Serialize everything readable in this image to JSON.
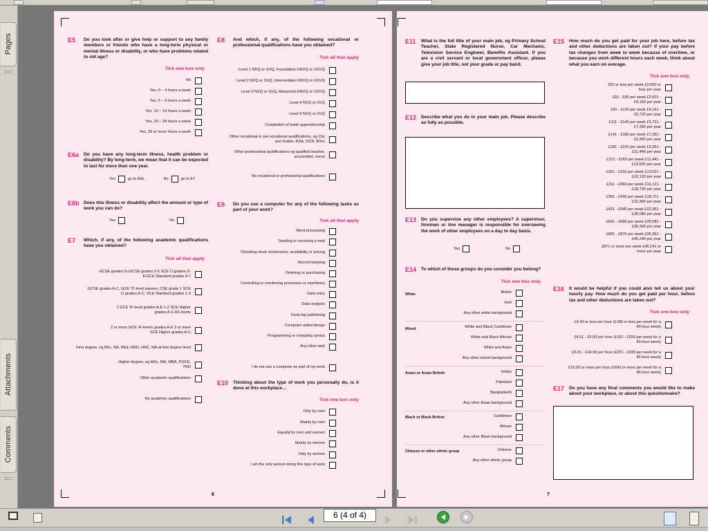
{
  "left_panel": {
    "tabs": [
      "Pages",
      "Attachments",
      "Comments"
    ]
  },
  "nav": {
    "page_display": "6 (4 of 4)"
  },
  "left_page": {
    "page_number": "6",
    "E5": {
      "num": "E5",
      "text": "Do you look after or give help or support to any family members or friends who have a long-term physical or mental illness or disability, or who have problems related to old age?",
      "instruction": "Tick one box only",
      "options": [
        "No",
        "Yes, 0 – 4 hours a week",
        "Yes, 5 – 9 hours a week",
        "Yes, 10 – 19 hours a week",
        "Yes, 20 – 34 hours a week",
        "Yes, 35 or more hours a week"
      ]
    },
    "E6a": {
      "num": "E6a",
      "text": "Do you have any long-term illness, health problem or disability? By long-term, we mean that it can be expected to last for more than one year.",
      "yes": "Yes",
      "goto_yes": "go to E6b",
      "no": "No",
      "goto_no": "go to E7"
    },
    "E6b": {
      "num": "E6b",
      "text": "Does this illness or disability affect the amount or type of work you can do?",
      "yes": "Yes",
      "no": "No"
    },
    "E7": {
      "num": "E7",
      "text": "Which, if any, of the following academic qualifications have you obtained?",
      "instruction": "Tick all that apply",
      "options": [
        "GCSE grades D-G/CSE grades 2-5 SCE O grades D-E/SCE Standard grades 4-7",
        "GCSE grades A-C, GCE 'O'-level passes, CSE grade 1 SCE O grades A-C, SCE Standard grades 1-3",
        "1 GCE 'A'-level grades A-E 1-2 SCE Higher grades A-C AS levels",
        "2 or more GCE 'A'-levels grades A-E 3 or more SCE Higher grades A-C",
        "First degree, eg BSc, BA, BEd, HND, HNC, MA at first degree level",
        "Higher degree, eg MSc, MA, MBA, PGCE, PhD",
        "Other academic qualifications",
        "No academic qualifications"
      ]
    },
    "E8": {
      "num": "E8",
      "text": "And which, if any, of the following vocational or professional qualifications have you obtained?",
      "instruction": "Tick all that apply",
      "options": [
        "Level 1 NVQ or SVQ, Foundation GNVQ or GSVQ",
        "Level 2 NVQ or SVQ, Intermediate GNVQ or GSVQ",
        "Level 3 NVQ or SVQ, Advanced GNVQ or GSVQ",
        "Level 4 NVQ or SVQ",
        "Level 5 NVQ or SVQ",
        "Completion of trade apprenticeship",
        "Other vocational or pre-vocational qualifications, eg City and Guilds, RSA, OCR, BTec",
        "Other professional qualifications eg qualified teacher, accountant, nurse",
        "No vocational or professional qualifications"
      ]
    },
    "E9": {
      "num": "E9",
      "text": "Do you use a computer for any of the following tasks as part of your work?",
      "instruction": "Tick all that apply",
      "options": [
        "Word processing",
        "Sending or receiving e-mail",
        "Checking stock movements, availability or pricing",
        "Record keeping",
        "Ordering or purchasing",
        "Controlling or monitoring processes or machinery",
        "Data entry",
        "Data analysis",
        "Desk-top publishing",
        "Computer-aided design",
        "Programming or compiling syntax",
        "Any other task",
        "I do not use a computer as part of my work"
      ]
    },
    "E10": {
      "num": "E10",
      "text": "Thinking about the type of work you personally do, is it done at this workplace…",
      "instruction": "Tick one box only",
      "options": [
        "Only by men",
        "Mainly by men",
        "Equally by men and women",
        "Mainly by women",
        "Only by women",
        "I am the only person doing this type of work"
      ]
    }
  },
  "right_page": {
    "page_number": "7",
    "E11": {
      "num": "E11",
      "text": "What is the full title of your main job, eg Primary School Teacher, State Registered Nurse, Car Mechanic, Television Service Engineer, Benefits Assistant. If you are a civil servant or local government officer, please give your job title, not your grade or pay band."
    },
    "E12": {
      "num": "E12",
      "text": "Describe what you do in your main job. Please describe as fully as possible."
    },
    "E13": {
      "num": "E13",
      "text": "Do you supervise any other employees? A supervisor, foreman or line manager is responsible for overseeing the work of other employees on a day to day basis.",
      "yes": "Yes",
      "no": "No"
    },
    "E14": {
      "num": "E14",
      "text": "To which of these groups do you consider you belong?",
      "instruction": "Tick one box only",
      "groups": [
        {
          "name": "White",
          "options": [
            "British",
            "Irish",
            "Any other white background"
          ]
        },
        {
          "name": "Mixed",
          "options": [
            "White and Black Caribbean",
            "White and Black African",
            "White and Asian",
            "Any other mixed background"
          ]
        },
        {
          "name": "Asian or Asian British",
          "options": [
            "Indian",
            "Pakistani",
            "Bangladeshi",
            "Any other Asian background"
          ]
        },
        {
          "name": "Black or Black British",
          "options": [
            "Caribbean",
            "African",
            "Any other Black background"
          ]
        },
        {
          "name": "Chinese or other ethnic group",
          "options": [
            "Chinese",
            "Any other ethnic group"
          ]
        }
      ]
    },
    "E15": {
      "num": "E15",
      "text": "How much do you get paid for your job here, before tax and other deductions are taken out? If your pay before tax changes from week to week because of overtime, or because you work different hours each week, think about what you earn on average.",
      "instruction": "Tick one box only",
      "options": [
        "£50 or less per week £2,600 or less per year",
        "£51 - £80 per week £2,601 - £4,160 per year",
        "£81 - £110 per week £4,161 - £5,720 per year",
        "£111 - £140 per week £5,721 - £7,280 per year",
        "£141 - £180 per week £7,281 - £9,360 per year",
        "£181 - £220 per week £9,361 - £11,440 per year",
        "£221 - £260 per week £11,441 - £13,520 per year",
        "£261 - £310 per week £13,521 - £16,120 per year",
        "£311 - £360 per week £16,121 - £18,720 per year",
        "£361 - £430 per week £18,721 - £22,360 per year",
        "£431 - £540 per week £22,361 - £28,080 per year",
        "£541 - £680 per week £28,081 - £35,360 per year",
        "£681 - £870 per week £35,361 - £45,240 per year",
        "£871 or more per week £45,241 or more per year"
      ]
    },
    "E16": {
      "num": "E16",
      "text": "It would be helpful if you could also tell us about your hourly pay. How much do you get paid per hour, before tax and other deductions are taken out?",
      "instruction": "Tick one box only",
      "options": [
        "£4.50 or less per hour (£180 or less per week for a 40-hour week)",
        "£4.51 - £5.00 per hour (£181 - £200 per week for a 40-hour week)",
        "£5.01 - £14.99 per hour (£201 - £599 per week for a 40-hour week)",
        "£15.00 or more per hour (£600 or more per week for a 40-hour week)"
      ]
    },
    "E17": {
      "num": "E17",
      "text": "Do you have any final comments you would like to make about your workplace, or about this questionnaire?"
    }
  }
}
